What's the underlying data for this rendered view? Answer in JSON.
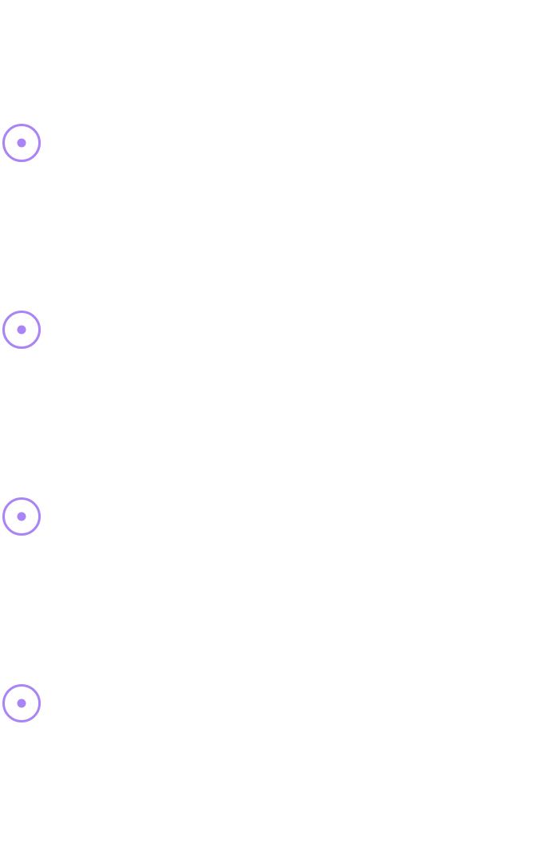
{
  "timeline": {
    "accent_color": "#a884f7",
    "marker_icon": "radio-dot-icon",
    "step_count": 4
  }
}
